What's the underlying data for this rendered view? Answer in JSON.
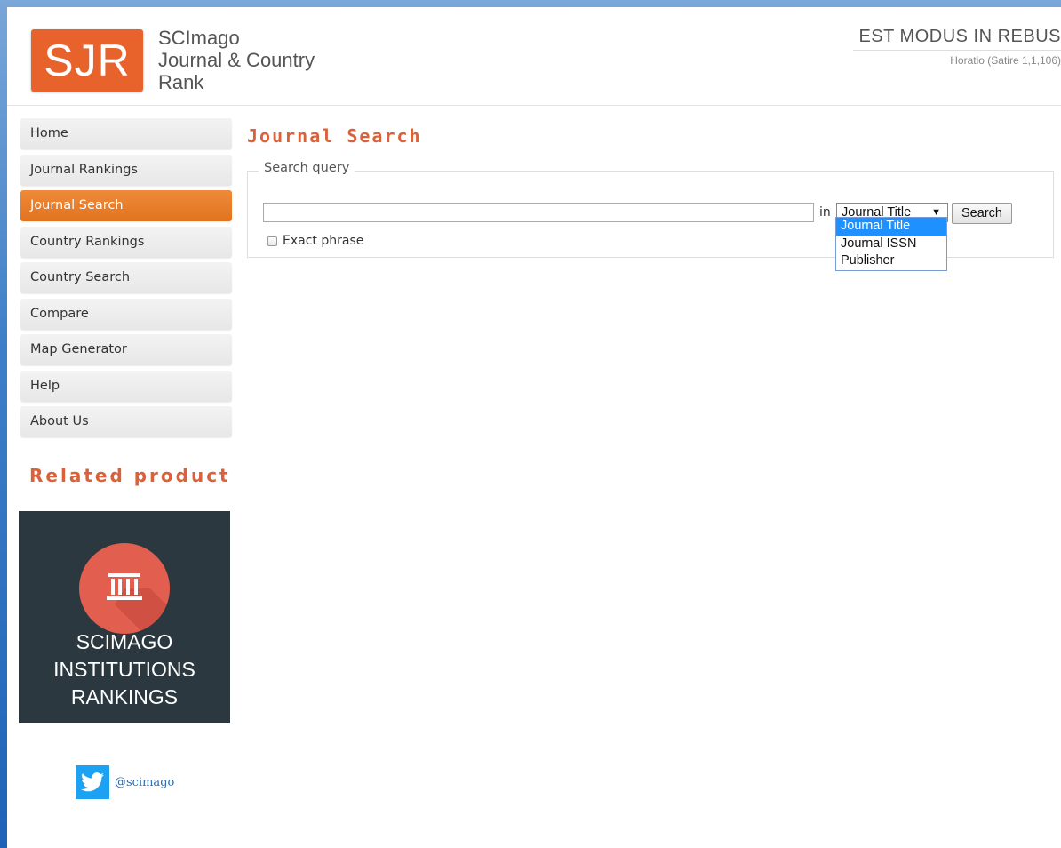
{
  "header": {
    "logo": "SJR",
    "site_name_line1": "SCImago",
    "site_name_line2": "Journal & Country",
    "site_name_line3": "Rank",
    "motto": "EST MODUS IN REBUS",
    "motto_source": "Horatio (Satire 1,1,106)"
  },
  "sidebar": {
    "items": [
      {
        "label": "Home"
      },
      {
        "label": "Journal Rankings"
      },
      {
        "label": "Journal Search",
        "active": true
      },
      {
        "label": "Country Rankings"
      },
      {
        "label": "Country Search"
      },
      {
        "label": "Compare"
      },
      {
        "label": "Map Generator"
      },
      {
        "label": "Help"
      },
      {
        "label": "About Us"
      }
    ],
    "related_title": "Related product",
    "promo": {
      "line1": "SCIMAGO",
      "line2": "INSTITUTIONS",
      "line3": "RANKINGS",
      "icon": "institution-icon"
    },
    "twitter": {
      "handle": "@scimago",
      "icon": "twitter-icon"
    }
  },
  "main": {
    "title": "Journal Search",
    "fieldset_legend": "Search query",
    "search_value": "",
    "in_label": "in",
    "select_value": "Journal Title",
    "search_button": "Search",
    "exact_phrase_label": "Exact phrase",
    "exact_phrase_checked": false,
    "dropdown_options": [
      {
        "label": "Journal Title",
        "selected": true
      },
      {
        "label": "Journal ISSN"
      },
      {
        "label": "Publisher"
      }
    ]
  },
  "colors": {
    "accent": "#e8622c",
    "nav_active": "#e2731f",
    "promo_bg": "#2c3840",
    "promo_circle": "#e25f4f",
    "twitter": "#1da1f2"
  }
}
